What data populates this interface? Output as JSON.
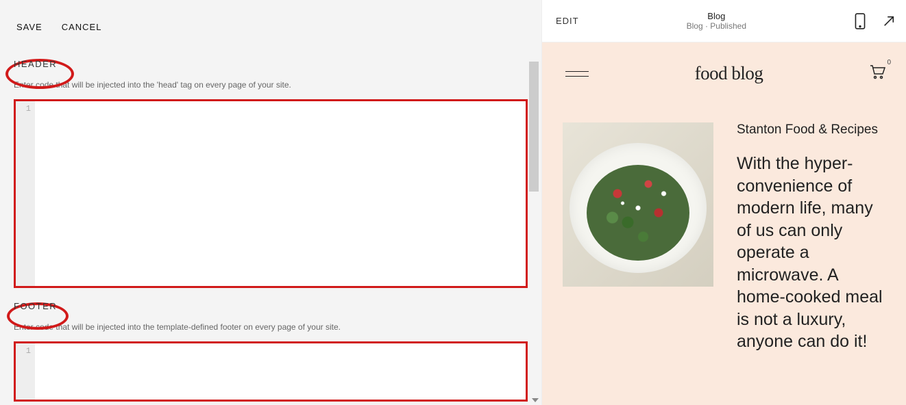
{
  "actions": {
    "save": "SAVE",
    "cancel": "CANCEL"
  },
  "sections": {
    "header": {
      "label": "HEADER",
      "description": "Enter code that will be injected into the 'head' tag on every page of your site.",
      "line_number": "1",
      "content": ""
    },
    "footer": {
      "label": "FOOTER",
      "description": "Enter code that will be injected into the template-defined footer on every page of your site.",
      "line_number": "1",
      "content": ""
    }
  },
  "preview": {
    "edit_label": "EDIT",
    "page_title": "Blog",
    "page_subtitle": "Blog · Published",
    "site_title": "food blog",
    "cart_count": "0",
    "post": {
      "category": "Stanton Food & Recipes",
      "excerpt": "With the hyper-convenience of modern life, many of us can only operate a microwave. A home-cooked meal is not a luxury, anyone can do it!"
    }
  }
}
